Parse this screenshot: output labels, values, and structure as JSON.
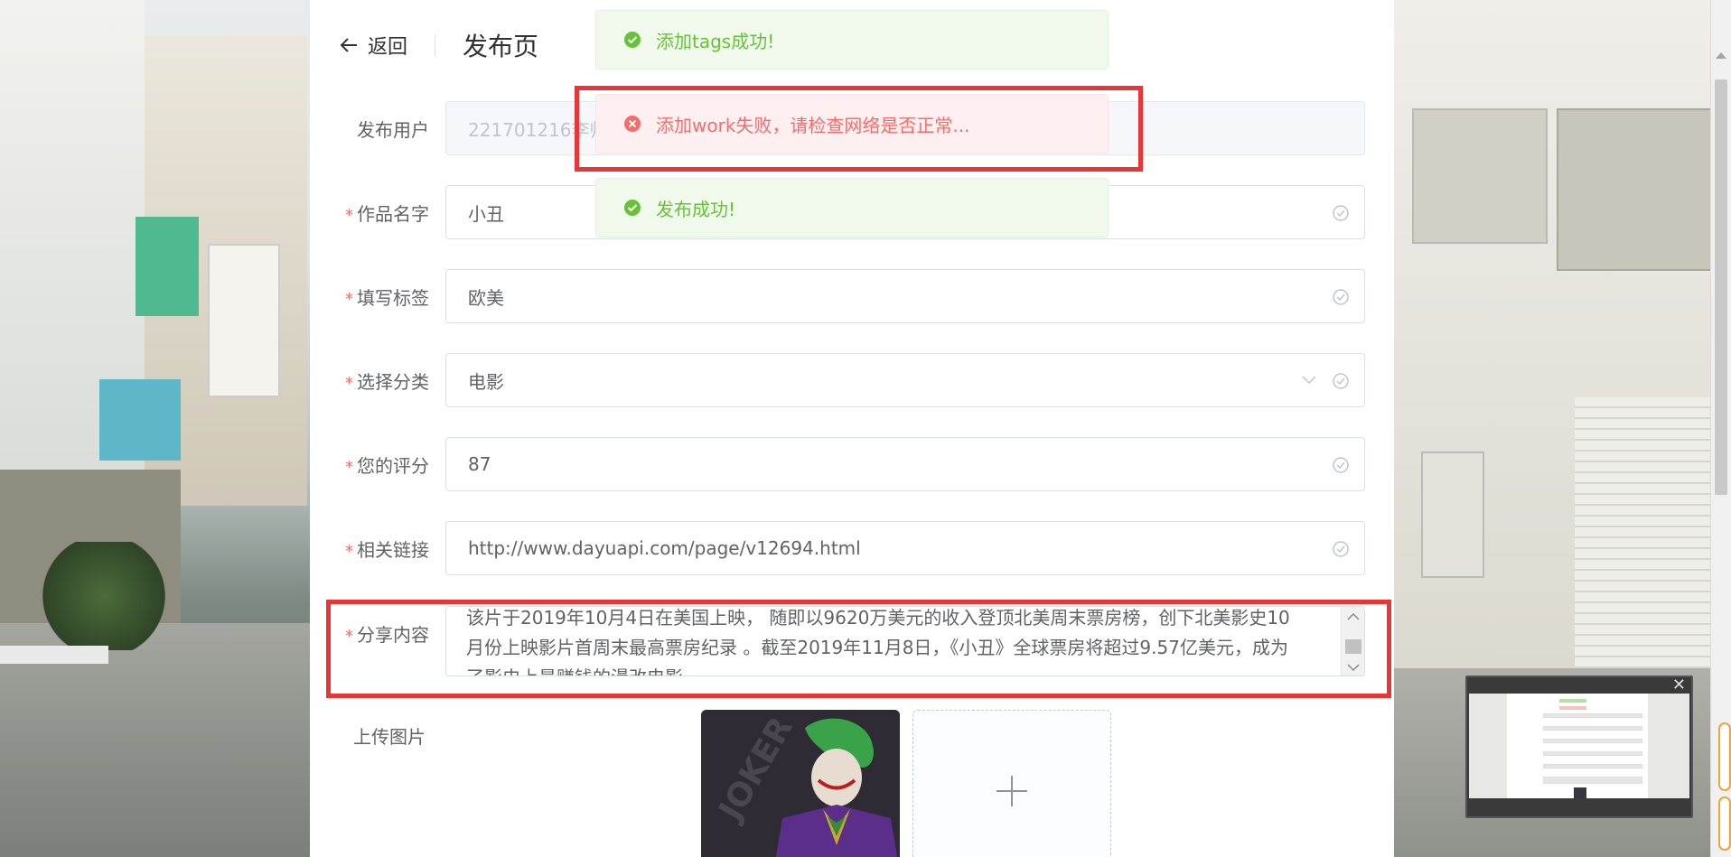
{
  "header": {
    "back_label": "返回",
    "title": "发布页"
  },
  "toasts": [
    {
      "type": "success",
      "text": "添加tags成功!"
    },
    {
      "type": "error",
      "text": "添加work失败，请检查网络是否正常..."
    },
    {
      "type": "success",
      "text": "发布成功!"
    }
  ],
  "form": {
    "user": {
      "label": "发布用户",
      "value": "221701216李帅"
    },
    "name": {
      "label": "作品名字",
      "value": "小丑"
    },
    "tags": {
      "label": "填写标签",
      "value": "欧美"
    },
    "category": {
      "label": "选择分类",
      "value": "电影"
    },
    "score": {
      "label": "您的评分",
      "value": "87"
    },
    "link": {
      "label": "相关链接",
      "value": "http://www.dayuapi.com/page/v12694.html"
    },
    "content": {
      "label": "分享内容",
      "line1": "该片于2019年10月4日在美国上映， 随即以9620万美元的收入登顶北美周末票房榜，创下北美影史10",
      "line2": "月份上映影片首周末最高票房纪录 。截至2019年11月8日，《小丑》全球票房将超过9.57亿美元，成为",
      "line3": "了影史上最赚钱的漫改电影"
    },
    "upload": {
      "label": "上传图片",
      "image_text": "JOKER"
    }
  },
  "colors": {
    "success": "#67c23a",
    "error": "#f56c6c",
    "highlight": "#e83535"
  }
}
